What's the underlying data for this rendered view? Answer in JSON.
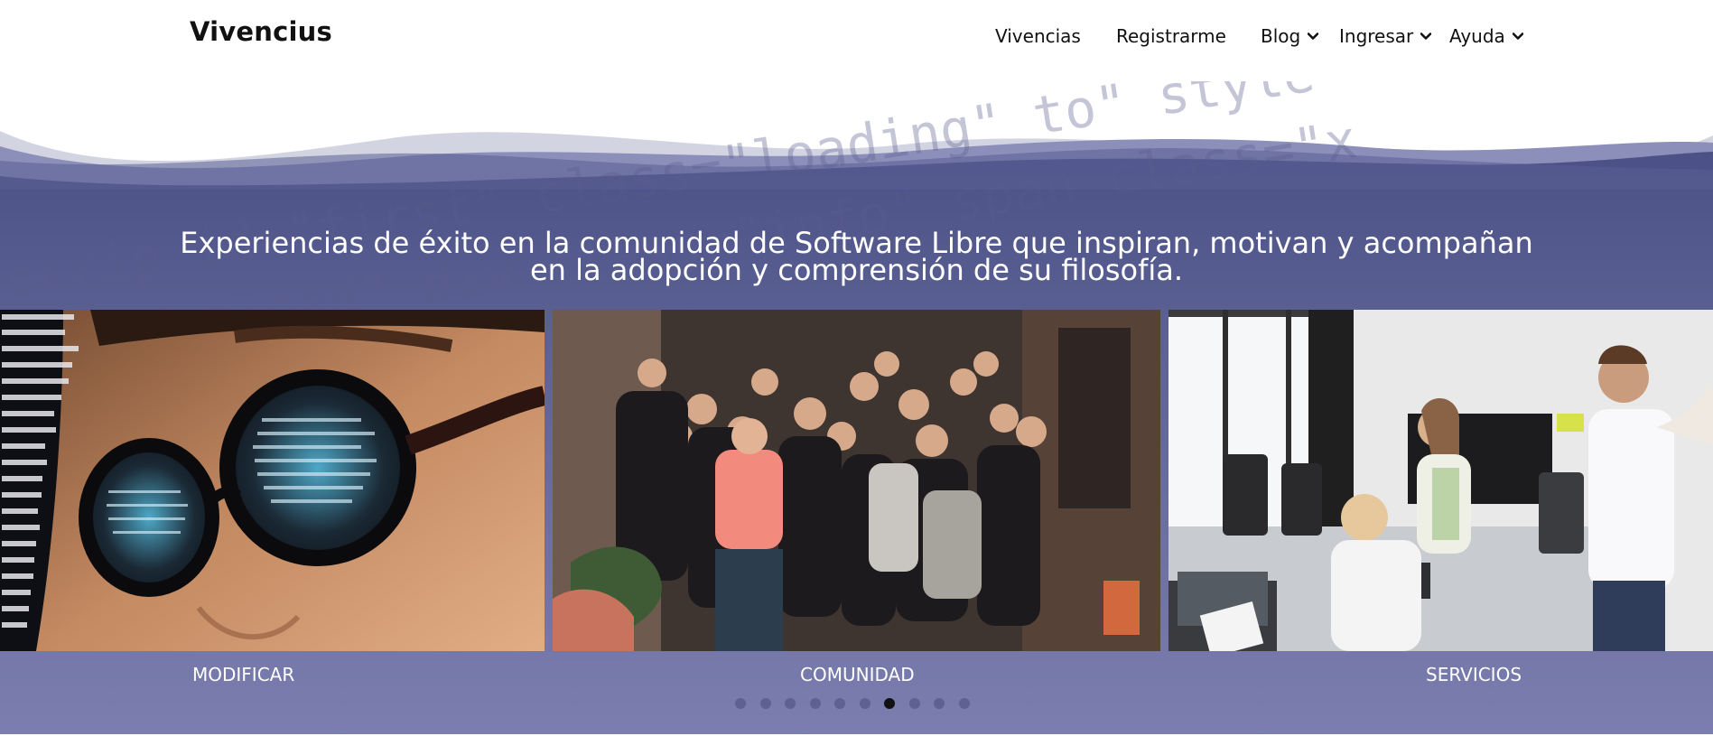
{
  "brand": "Vivencius",
  "nav": {
    "vivencias": "Vivencias",
    "registrarme": "Registrarme",
    "blog": "Blog",
    "ingresar": "Ingresar",
    "ayuda": "Ayuda"
  },
  "hero": {
    "tagline_line1": "Experiencias de éxito en la comunidad de Software Libre que inspiran, motivan y acompañan",
    "tagline_line2": "en la adopción y comprensión de su filosofía."
  },
  "carousel": {
    "slides": [
      {
        "label": "MODIFICAR"
      },
      {
        "label": "COMUNIDAD"
      },
      {
        "label": "SERVICIOS"
      }
    ],
    "dot_count": 10,
    "active_dot": 7
  },
  "watermark_code": [
    "scrip id=\"first\" class=\"loading\" to\" style=\"roun",
    "an id=\"load\" div class=\"info\" span class=\"x"
  ],
  "colors": {
    "hero_top": "#4e5387",
    "hero_bottom": "#7c7fae",
    "wave_light": "#d3d4e2",
    "wave_mid": "#8d8fbb",
    "dot_active": "#111111",
    "dot_inactive": "#5f6192"
  },
  "icons": {
    "caret": "chevron-down-icon"
  }
}
